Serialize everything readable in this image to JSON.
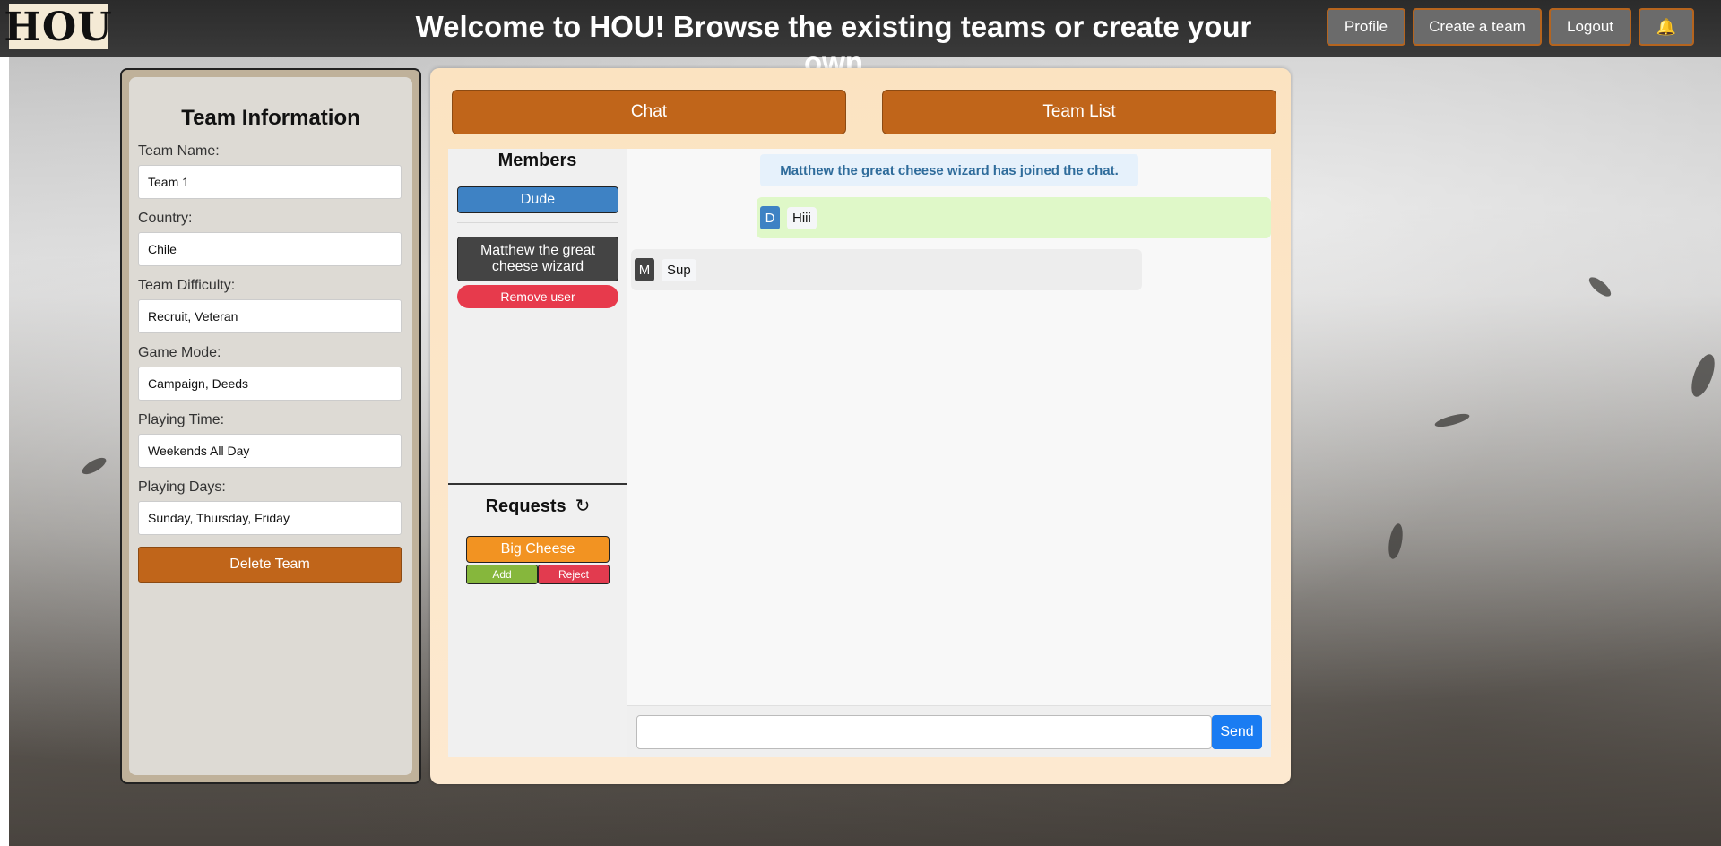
{
  "header": {
    "logo_text": "HOU",
    "title": "Welcome to HOU! Browse the existing teams or create your own",
    "nav": {
      "profile": "Profile",
      "create_team": "Create a team",
      "logout": "Logout",
      "bell": "🔔"
    }
  },
  "team_info": {
    "title": "Team Information",
    "fields": [
      {
        "label": "Team Name:",
        "value": "Team 1"
      },
      {
        "label": "Country:",
        "value": "Chile"
      },
      {
        "label": "Team Difficulty:",
        "value": "Recruit, Veteran"
      },
      {
        "label": "Game Mode:",
        "value": "Campaign, Deeds"
      },
      {
        "label": "Playing Time:",
        "value": "Weekends All Day"
      },
      {
        "label": "Playing Days:",
        "value": "Sunday, Thursday, Friday"
      }
    ],
    "delete_label": "Delete Team"
  },
  "tabs": {
    "chat": "Chat",
    "team_list": "Team List"
  },
  "members": {
    "title": "Members",
    "list": [
      "Dude",
      "Matthew the great cheese wizard"
    ],
    "remove_label": "Remove user"
  },
  "requests": {
    "title": "Requests",
    "refresh_glyph": "↻",
    "items": [
      {
        "name": "Big Cheese",
        "add_label": "Add",
        "reject_label": "Reject"
      }
    ]
  },
  "chat": {
    "system_message": "Matthew the great cheese wizard has joined the chat.",
    "messages": [
      {
        "initial": "D",
        "text": "Hiii",
        "avatar_color": "#3e82c4"
      },
      {
        "initial": "M",
        "text": "Sup",
        "avatar_color": "#444444"
      }
    ],
    "input_value": "",
    "send_label": "Send"
  },
  "colors": {
    "accent": "#c0651a",
    "request": "#f29322",
    "add": "#86b73c",
    "reject": "#e23b4f",
    "send": "#1a7cf2"
  }
}
